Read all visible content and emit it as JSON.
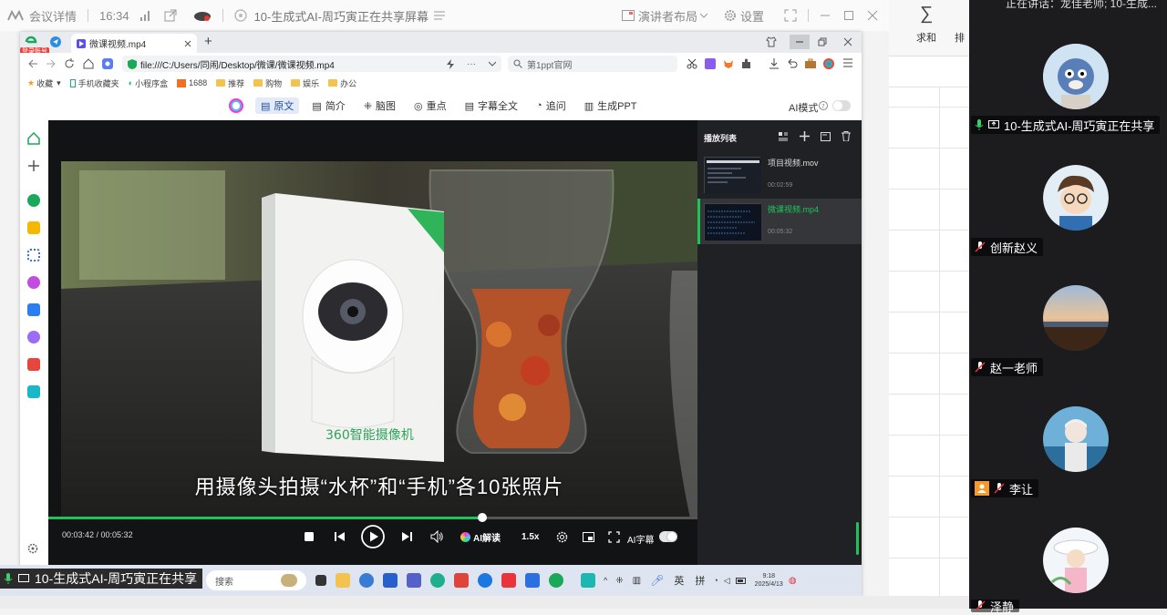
{
  "meeting": {
    "title": "会议详情",
    "time": "16:34",
    "share_title": "10-生成式AI-周巧寅正在共享屏幕",
    "presenter_layout": "演讲者布局",
    "settings": "设置"
  },
  "excel": {
    "ribbon_items": [
      "求和",
      "排"
    ]
  },
  "panel": {
    "speaking": "正在讲话：龙佳老师; 10-生成...",
    "participants": [
      {
        "name": "10-生成式AI-周巧寅正在共享"
      },
      {
        "name": "创新赵义"
      },
      {
        "name": "赵一老师"
      },
      {
        "name": "李让"
      },
      {
        "name": "泽静"
      }
    ]
  },
  "browser": {
    "tab_title": "微课视频.mp4",
    "url": "file:///C:/Users/同闹/Desktop/微课/微课视频.mp4",
    "search_placeholder": "第1ppt官网",
    "badge": "登录账号",
    "bookmarks": [
      "收藏",
      "手机收藏夹",
      "小程序盒",
      "1688",
      "推荐",
      "购物",
      "娱乐",
      "办公"
    ],
    "toolbar": {
      "tabs": [
        "原文",
        "简介",
        "脑图",
        "重点",
        "字幕全文",
        "追问",
        "生成PPT"
      ],
      "ai_mode": "AI模式"
    }
  },
  "player": {
    "subtitle": "用摄像头拍摄“水杯”和“手机”各10张照片",
    "time": "00:03:42 / 00:05:32",
    "progress": 0.669,
    "ai_read": "AI解读",
    "speed": "1.5x",
    "ai_subtitle": "AI字幕",
    "box_brand": "360智能摄像机",
    "playlist_title": "播放列表",
    "playlist": [
      {
        "name": "项目视频.mov",
        "duration": "00:02:59",
        "active": false
      },
      {
        "name": "微课视频.mp4",
        "duration": "00:05:32",
        "active": true
      }
    ]
  },
  "taskbar": {
    "share_label": "10-生成式AI-周巧寅正在共享",
    "search": "搜索",
    "ime1": "英",
    "ime2": "拼",
    "time": "9:18",
    "date": "2025/4/13"
  }
}
